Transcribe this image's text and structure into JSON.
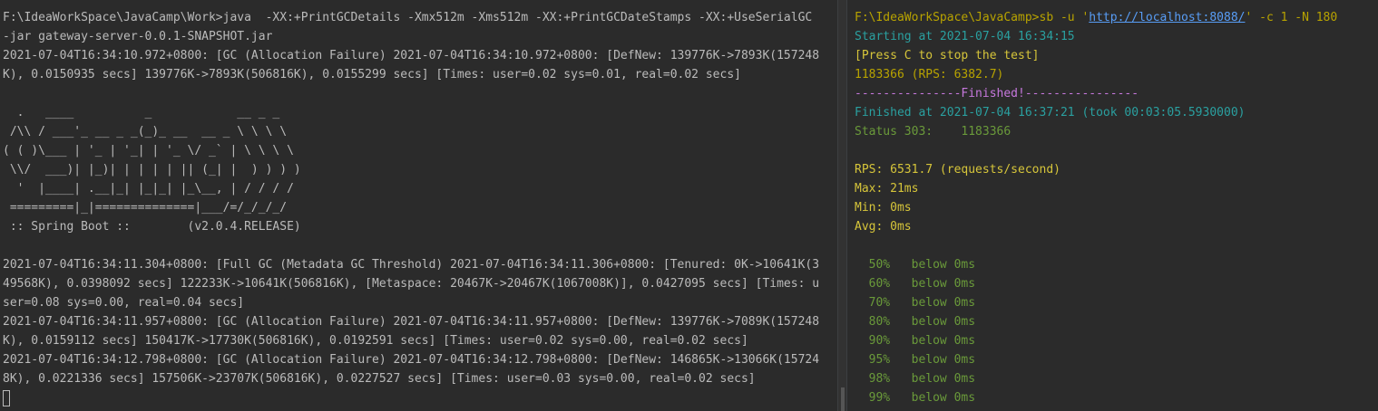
{
  "left_terminal": {
    "lines": [
      "F:\\IdeaWorkSpace\\JavaCamp\\Work>java  -XX:+PrintGCDetails -Xmx512m -Xms512m -XX:+PrintGCDateStamps -XX:+UseSerialGC",
      "-jar gateway-server-0.0.1-SNAPSHOT.jar",
      "2021-07-04T16:34:10.972+0800: [GC (Allocation Failure) 2021-07-04T16:34:10.972+0800: [DefNew: 139776K->7893K(157248",
      "K), 0.0150935 secs] 139776K->7893K(506816K), 0.0155299 secs] [Times: user=0.02 sys=0.01, real=0.02 secs]",
      "",
      "  .   ____          _            __ _ _",
      " /\\\\ / ___'_ __ _ _(_)_ __  __ _ \\ \\ \\ \\",
      "( ( )\\___ | '_ | '_| | '_ \\/ _` | \\ \\ \\ \\",
      " \\\\/  ___)| |_)| | | | | || (_| |  ) ) ) )",
      "  '  |____| .__|_| |_|_| |_\\__, | / / / /",
      " =========|_|==============|___/=/_/_/_/",
      " :: Spring Boot ::        (v2.0.4.RELEASE)",
      "",
      "2021-07-04T16:34:11.304+0800: [Full GC (Metadata GC Threshold) 2021-07-04T16:34:11.306+0800: [Tenured: 0K->10641K(3",
      "49568K), 0.0398092 secs] 122233K->10641K(506816K), [Metaspace: 20467K->20467K(1067008K)], 0.0427095 secs] [Times: u",
      "ser=0.08 sys=0.00, real=0.04 secs]",
      "2021-07-04T16:34:11.957+0800: [GC (Allocation Failure) 2021-07-04T16:34:11.957+0800: [DefNew: 139776K->7089K(157248",
      "K), 0.0159112 secs] 150417K->17730K(506816K), 0.0192591 secs] [Times: user=0.02 sys=0.00, real=0.02 secs]",
      "2021-07-04T16:34:12.798+0800: [GC (Allocation Failure) 2021-07-04T16:34:12.798+0800: [DefNew: 146865K->13066K(15724",
      "8K), 0.0221336 secs] 157506K->23707K(506816K), 0.0227527 secs] [Times: user=0.03 sys=0.00, real=0.02 secs]"
    ]
  },
  "right_terminal": {
    "command_prefix": "F:\\IdeaWorkSpace\\JavaCamp>sb -u '",
    "command_url": "http://localhost:8088/",
    "command_suffix": "' -c 1 -N 180",
    "starting": "Starting at 2021-07-04 16:34:15",
    "press_c": "[Press C to stop the test]",
    "progress": "1183366 (RPS: 6382.7)",
    "finished_banner": "---------------Finished!----------------",
    "finished_at": "Finished at 2021-07-04 16:37:21 (took 00:03:05.5930000)",
    "status": "Status 303:    1183366",
    "rps": "RPS: 6531.7 (requests/second)",
    "max": "Max: 21ms",
    "min": "Min: 0ms",
    "avg": "Avg: 0ms",
    "percentiles": [
      "  50%   below 0ms",
      "  60%   below 0ms",
      "  70%   below 0ms",
      "  80%   below 0ms",
      "  90%   below 0ms",
      "  95%   below 0ms",
      "  98%   below 0ms",
      "  99%   below 0ms"
    ]
  },
  "colors": {
    "background": "#2b2b2b",
    "text": "#bbbbbb",
    "cyan": "#2aa0a0",
    "yellow": "#d6c53a",
    "magenta": "#c678dd",
    "green": "#6a9a3a",
    "link": "#589df6"
  }
}
